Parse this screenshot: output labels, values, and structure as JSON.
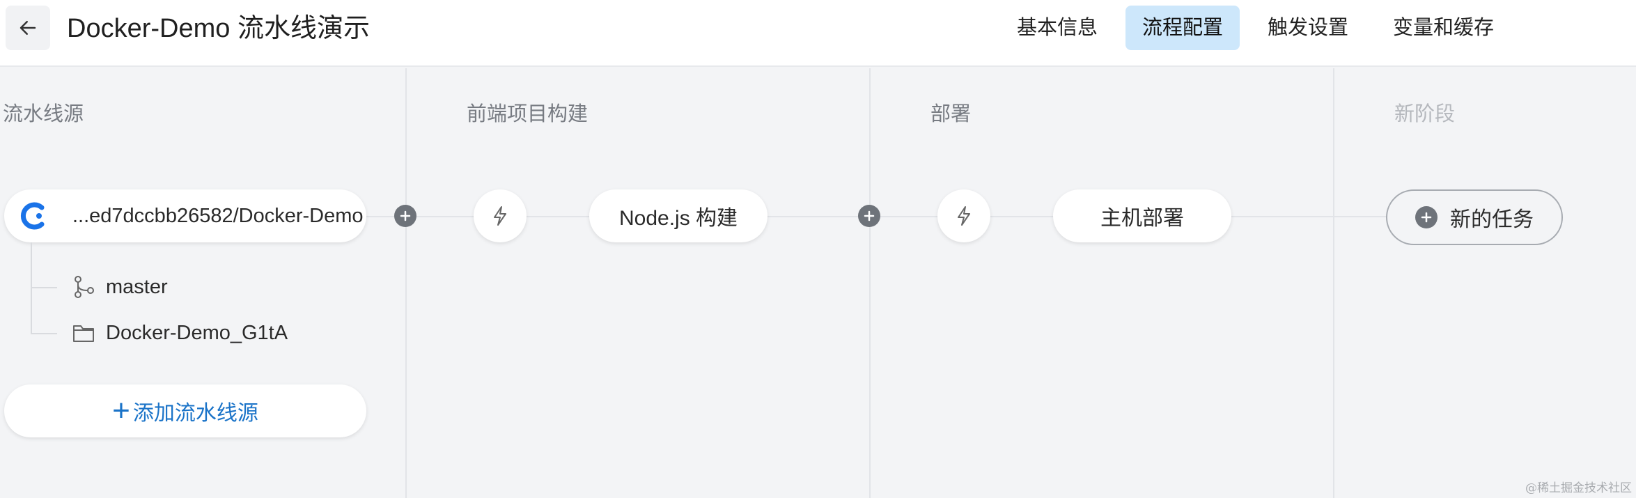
{
  "header": {
    "title": "Docker-Demo 流水线演示",
    "tabs": [
      {
        "label": "基本信息",
        "active": false
      },
      {
        "label": "流程配置",
        "active": true
      },
      {
        "label": "触发设置",
        "active": false
      },
      {
        "label": "变量和缓存",
        "active": false
      }
    ]
  },
  "stages": [
    {
      "title": "流水线源"
    },
    {
      "title": "前端项目构建"
    },
    {
      "title": "部署"
    },
    {
      "title": "新阶段"
    }
  ],
  "source": {
    "repo": "...ed7dccbb26582/Docker-Demo",
    "branch": "master",
    "folder": "Docker-Demo_G1tA",
    "add_label": "添加流水线源"
  },
  "tasks": {
    "build": "Node.js 构建",
    "deploy": "主机部署",
    "new_task": "新的任务"
  },
  "watermark": "@稀土掘金技术社区",
  "colors": {
    "accent_tab": "#cde7fb",
    "link_blue": "#1a73c8",
    "background": "#f3f4f6"
  }
}
